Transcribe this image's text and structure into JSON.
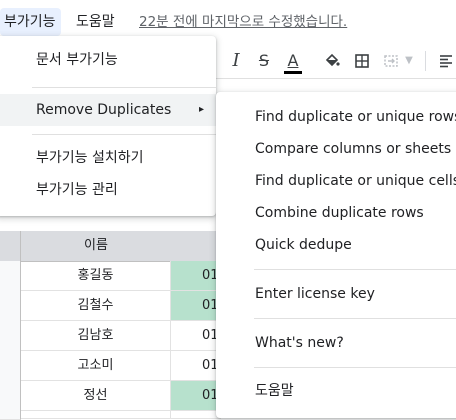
{
  "menubar": {
    "addons": "부가기능",
    "help": "도움말",
    "last_edit": "22분 전에 마지막으로 수정했습니다."
  },
  "toolbar": {
    "italic": "I",
    "strike": "S",
    "text_color": "A",
    "fill_icon": "paint-bucket-icon",
    "borders_icon": "borders-icon",
    "merge_icon": "merge-cells-icon",
    "align_icon": "align-left-icon"
  },
  "sheet": {
    "column_header": "이름",
    "rows": [
      {
        "name": "홍길동",
        "id": "01",
        "highlight": true
      },
      {
        "name": "김철수",
        "id": "01",
        "highlight": true
      },
      {
        "name": "김남호",
        "id": "01",
        "highlight": false
      },
      {
        "name": "고소미",
        "id": "01",
        "highlight": false
      },
      {
        "name": "정선",
        "id": "01",
        "highlight": true
      }
    ],
    "highlight_color": "#b7e1cd",
    "header_color": "#dadce0"
  },
  "addons_menu": {
    "items": [
      {
        "label": "문서 부가기능"
      },
      {
        "label": "Remove Duplicates",
        "submenu_arrow": "▸"
      },
      {
        "label": "부가기능 설치하기"
      },
      {
        "label": "부가기능 관리"
      }
    ]
  },
  "remove_duplicates_menu": {
    "items": [
      {
        "label": "Find duplicate or unique rows"
      },
      {
        "label": "Compare columns or sheets"
      },
      {
        "label": "Find duplicate or unique cells"
      },
      {
        "label": "Combine duplicate rows"
      },
      {
        "label": "Quick dedupe"
      },
      {
        "label": "Enter license key"
      },
      {
        "label": "What's new?"
      },
      {
        "label": "도움말"
      }
    ]
  }
}
